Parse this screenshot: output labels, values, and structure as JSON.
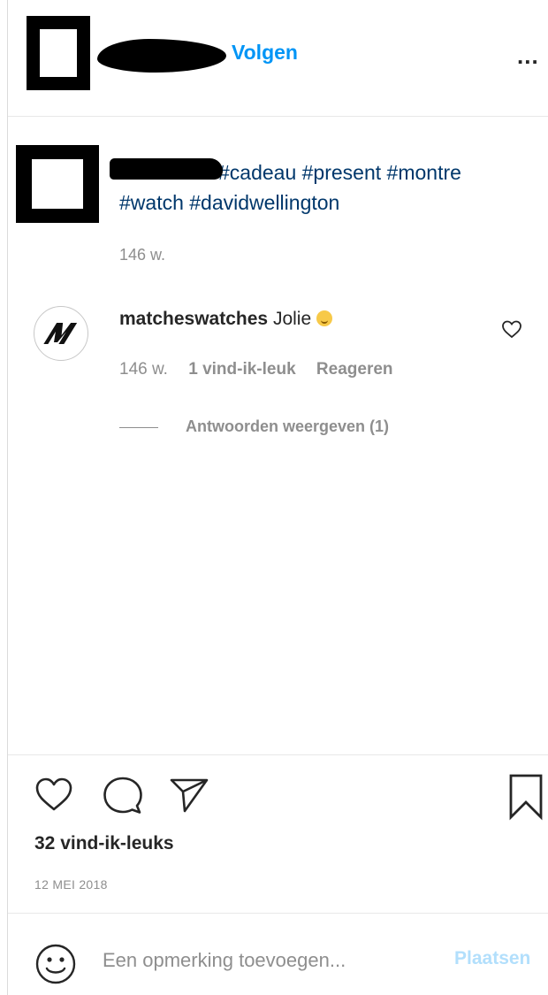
{
  "header": {
    "follow_label": "Volgen",
    "more_label": "..."
  },
  "caption": {
    "hashtags_line1": "#cadeau #present #montre",
    "hashtags_line2": "#watch #davidwellington",
    "time": "146 w."
  },
  "comment": {
    "username": "matcheswatches",
    "text": "Jolie",
    "time": "146 w.",
    "likes": "1 vind-ik-leuk",
    "reply_label": "Reageren",
    "view_replies": "Antwoorden weergeven (1)"
  },
  "post": {
    "likes": "32 vind-ik-leuks",
    "date": "12 MEI 2018"
  },
  "comment_input": {
    "placeholder": "Een opmerking toevoegen...",
    "post_label": "Plaatsen"
  },
  "colors": {
    "link_blue": "#0095f6",
    "hashtag": "#00376b",
    "muted": "#8e8e8e",
    "post_disabled": "#b2dffc"
  },
  "icons": {
    "header": [
      "avatar-redacted",
      "more-options-icon"
    ],
    "comment": [
      "heart-outline-icon",
      "emoji-smile-icon"
    ],
    "actions": [
      "heart-outline-icon",
      "comment-bubble-icon",
      "share-paper-plane-icon",
      "bookmark-outline-icon"
    ],
    "input": [
      "smiley-face-icon"
    ]
  }
}
